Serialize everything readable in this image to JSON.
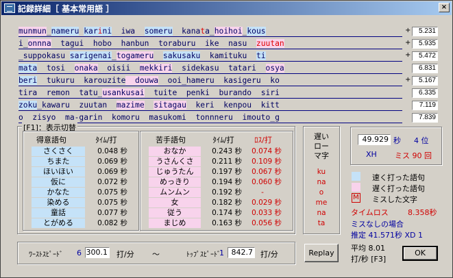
{
  "window": {
    "title": "記録詳細［ 基本常用語 ］",
    "close_label": "×"
  },
  "text_lines": [
    {
      "time": "5.231",
      "plus": "+",
      "segs": [
        {
          "t": "munmun",
          "c": "slow"
        },
        {
          "t": "_",
          "c": ""
        },
        {
          "t": "nameru",
          "c": "fast"
        },
        {
          "t": " ",
          "c": ""
        },
        {
          "t": "kar",
          "c": "fast"
        },
        {
          "t": "i",
          "c": "fast miss"
        },
        {
          "t": "ni",
          "c": "fast"
        },
        {
          "t": "  iwa  ",
          "c": ""
        },
        {
          "t": "someru",
          "c": "fast"
        },
        {
          "t": "  kana",
          "c": ""
        },
        {
          "t": "t",
          "c": "miss"
        },
        {
          "t": "a_",
          "c": ""
        },
        {
          "t": "hoihoi",
          "c": "slow"
        },
        {
          "t": "_",
          "c": ""
        },
        {
          "t": "kous",
          "c": "fast"
        }
      ]
    },
    {
      "time": "5.935",
      "plus": "+",
      "segs": [
        {
          "t": "i",
          "c": ""
        },
        {
          "t": "_",
          "c": ""
        },
        {
          "t": "onnna",
          "c": "slow"
        },
        {
          "t": "  tagui  hobo  hanbun  ",
          "c": ""
        },
        {
          "t": "toraburu",
          "c": ""
        },
        {
          "t": "  ike  nasu  ",
          "c": ""
        },
        {
          "t": "zuutan",
          "c": "slow miss"
        }
      ]
    },
    {
      "time": "5.472",
      "plus": "+",
      "segs": [
        {
          "t": "_suppokasu",
          "c": ""
        },
        {
          "t": " ",
          "c": ""
        },
        {
          "t": "sarigenai",
          "c": "fast"
        },
        {
          "t": "_",
          "c": ""
        },
        {
          "t": "togameru",
          "c": "slow"
        },
        {
          "t": "  ",
          "c": ""
        },
        {
          "t": "sakusaku",
          "c": "fast"
        },
        {
          "t": "  kamituku  ",
          "c": ""
        },
        {
          "t": "ti",
          "c": "fast"
        }
      ]
    },
    {
      "time": "6.831",
      "plus": "",
      "segs": [
        {
          "t": "mata",
          "c": "fast"
        },
        {
          "t": "  tosi  ",
          "c": ""
        },
        {
          "t": "onaka",
          "c": "slow"
        },
        {
          "t": "  oisii  ",
          "c": ""
        },
        {
          "t": "mekkiri",
          "c": "slow"
        },
        {
          "t": "  sidekasu  tatari  ",
          "c": ""
        },
        {
          "t": "osya",
          "c": "slow"
        }
      ]
    },
    {
      "time": "5.167",
      "plus": "+",
      "segs": [
        {
          "t": "beri",
          "c": "fast"
        },
        {
          "t": "  tukuru  ",
          "c": ""
        },
        {
          "t": "karouzite",
          "c": ""
        },
        {
          "t": "  douwa",
          "c": "slow"
        },
        {
          "t": "  ooi_hameru  kasigeru  ko",
          "c": ""
        }
      ]
    },
    {
      "time": "6.335",
      "plus": "",
      "segs": [
        {
          "t": "tira  remon  tatu_",
          "c": ""
        },
        {
          "t": "usankusai",
          "c": "slow"
        },
        {
          "t": "  tuite  penki  burando  siri",
          "c": ""
        }
      ]
    },
    {
      "time": "7.119",
      "plus": "",
      "segs": [
        {
          "t": "zoku",
          "c": "fast"
        },
        {
          "t": "_kawaru  zuutan  ",
          "c": ""
        },
        {
          "t": "mazime",
          "c": "slow"
        },
        {
          "t": "  ",
          "c": ""
        },
        {
          "t": "sitagau",
          "c": "slow"
        },
        {
          "t": "  keri  kenpou  kitt",
          "c": ""
        }
      ]
    },
    {
      "time": "7.839",
      "plus": "",
      "segs": [
        {
          "t": "o  zisyo  ma-garin  komoru  masukomi  tonnneru  imouto_g",
          "c": ""
        }
      ]
    }
  ],
  "toggle_group": {
    "title": "[F1]：表示切替"
  },
  "good_words": {
    "header_word": "得意語句",
    "header_time": "ﾀｲﾑ/打",
    "rows": [
      {
        "word": "さくさく",
        "time": "0.048 秒"
      },
      {
        "word": "ちまた",
        "time": "0.069 秒"
      },
      {
        "word": "ほいほい",
        "time": "0.069 秒"
      },
      {
        "word": "仮に",
        "time": "0.072 秒"
      },
      {
        "word": "かなた",
        "time": "0.075 秒"
      },
      {
        "word": "染める",
        "time": "0.075 秒"
      },
      {
        "word": "童話",
        "time": "0.077 秒"
      },
      {
        "word": "とがめる",
        "time": "0.082 秒"
      }
    ]
  },
  "bad_words": {
    "header_word": "苦手語句",
    "header_time": "ﾀｲﾑ/打",
    "header_loss": "ﾛｽ/打",
    "rows": [
      {
        "word": "おなか",
        "time": "0.243 秒",
        "loss": "0.074 秒"
      },
      {
        "word": "うさんくさ",
        "time": "0.211 秒",
        "loss": "0.109 秒"
      },
      {
        "word": "じゅうたん",
        "time": "0.197 秒",
        "loss": "0.067 秒"
      },
      {
        "word": "めっきり",
        "time": "0.194 秒",
        "loss": "0.060 秒"
      },
      {
        "word": "ムンムン",
        "time": "0.192 秒",
        "loss": "-"
      },
      {
        "word": "女",
        "time": "0.182 秒",
        "loss": "0.029 秒"
      },
      {
        "word": "従う",
        "time": "0.174 秒",
        "loss": "0.033 秒"
      },
      {
        "word": "まじめ",
        "time": "0.163 秒",
        "loss": "0.056 秒"
      }
    ]
  },
  "slow_romaji": {
    "title_lines": [
      "遅い",
      "ロー",
      "マ字"
    ],
    "items": [
      "ku",
      "na",
      "o",
      "me",
      "na",
      "ta"
    ]
  },
  "stats": {
    "time_value": "49.929",
    "time_unit": "秒",
    "rank": "4 位",
    "level": "XH",
    "miss_label": "ミス 90 回"
  },
  "legend": {
    "fast": "速く打った語句",
    "slow": "遅く打った語句",
    "miss_mark": "M",
    "miss": "ミスした文字",
    "fast_color": "#c5e2f8",
    "slow_color": "#f8d3ec"
  },
  "time_loss": {
    "label": "タイムロス",
    "value": "8.358秒"
  },
  "no_miss": {
    "label": "ミスなしの場合",
    "estimate": "推定  41.571秒 XD 1"
  },
  "average": {
    "label": "平均  8.01",
    "sub": "打/秒 [F3]"
  },
  "speed": {
    "worst_label": "ﾜｰｽﾄｽﾋﾟｰﾄﾞ",
    "worst_num": "6",
    "worst_value": "300.1",
    "unit": "打/分",
    "tilde": "～",
    "top_label": "ﾄｯﾌﾟｽﾋﾟｰﾄﾞ",
    "top_num": "1",
    "top_value": "842.7"
  },
  "buttons": {
    "replay": "Replay",
    "ok": "OK"
  }
}
